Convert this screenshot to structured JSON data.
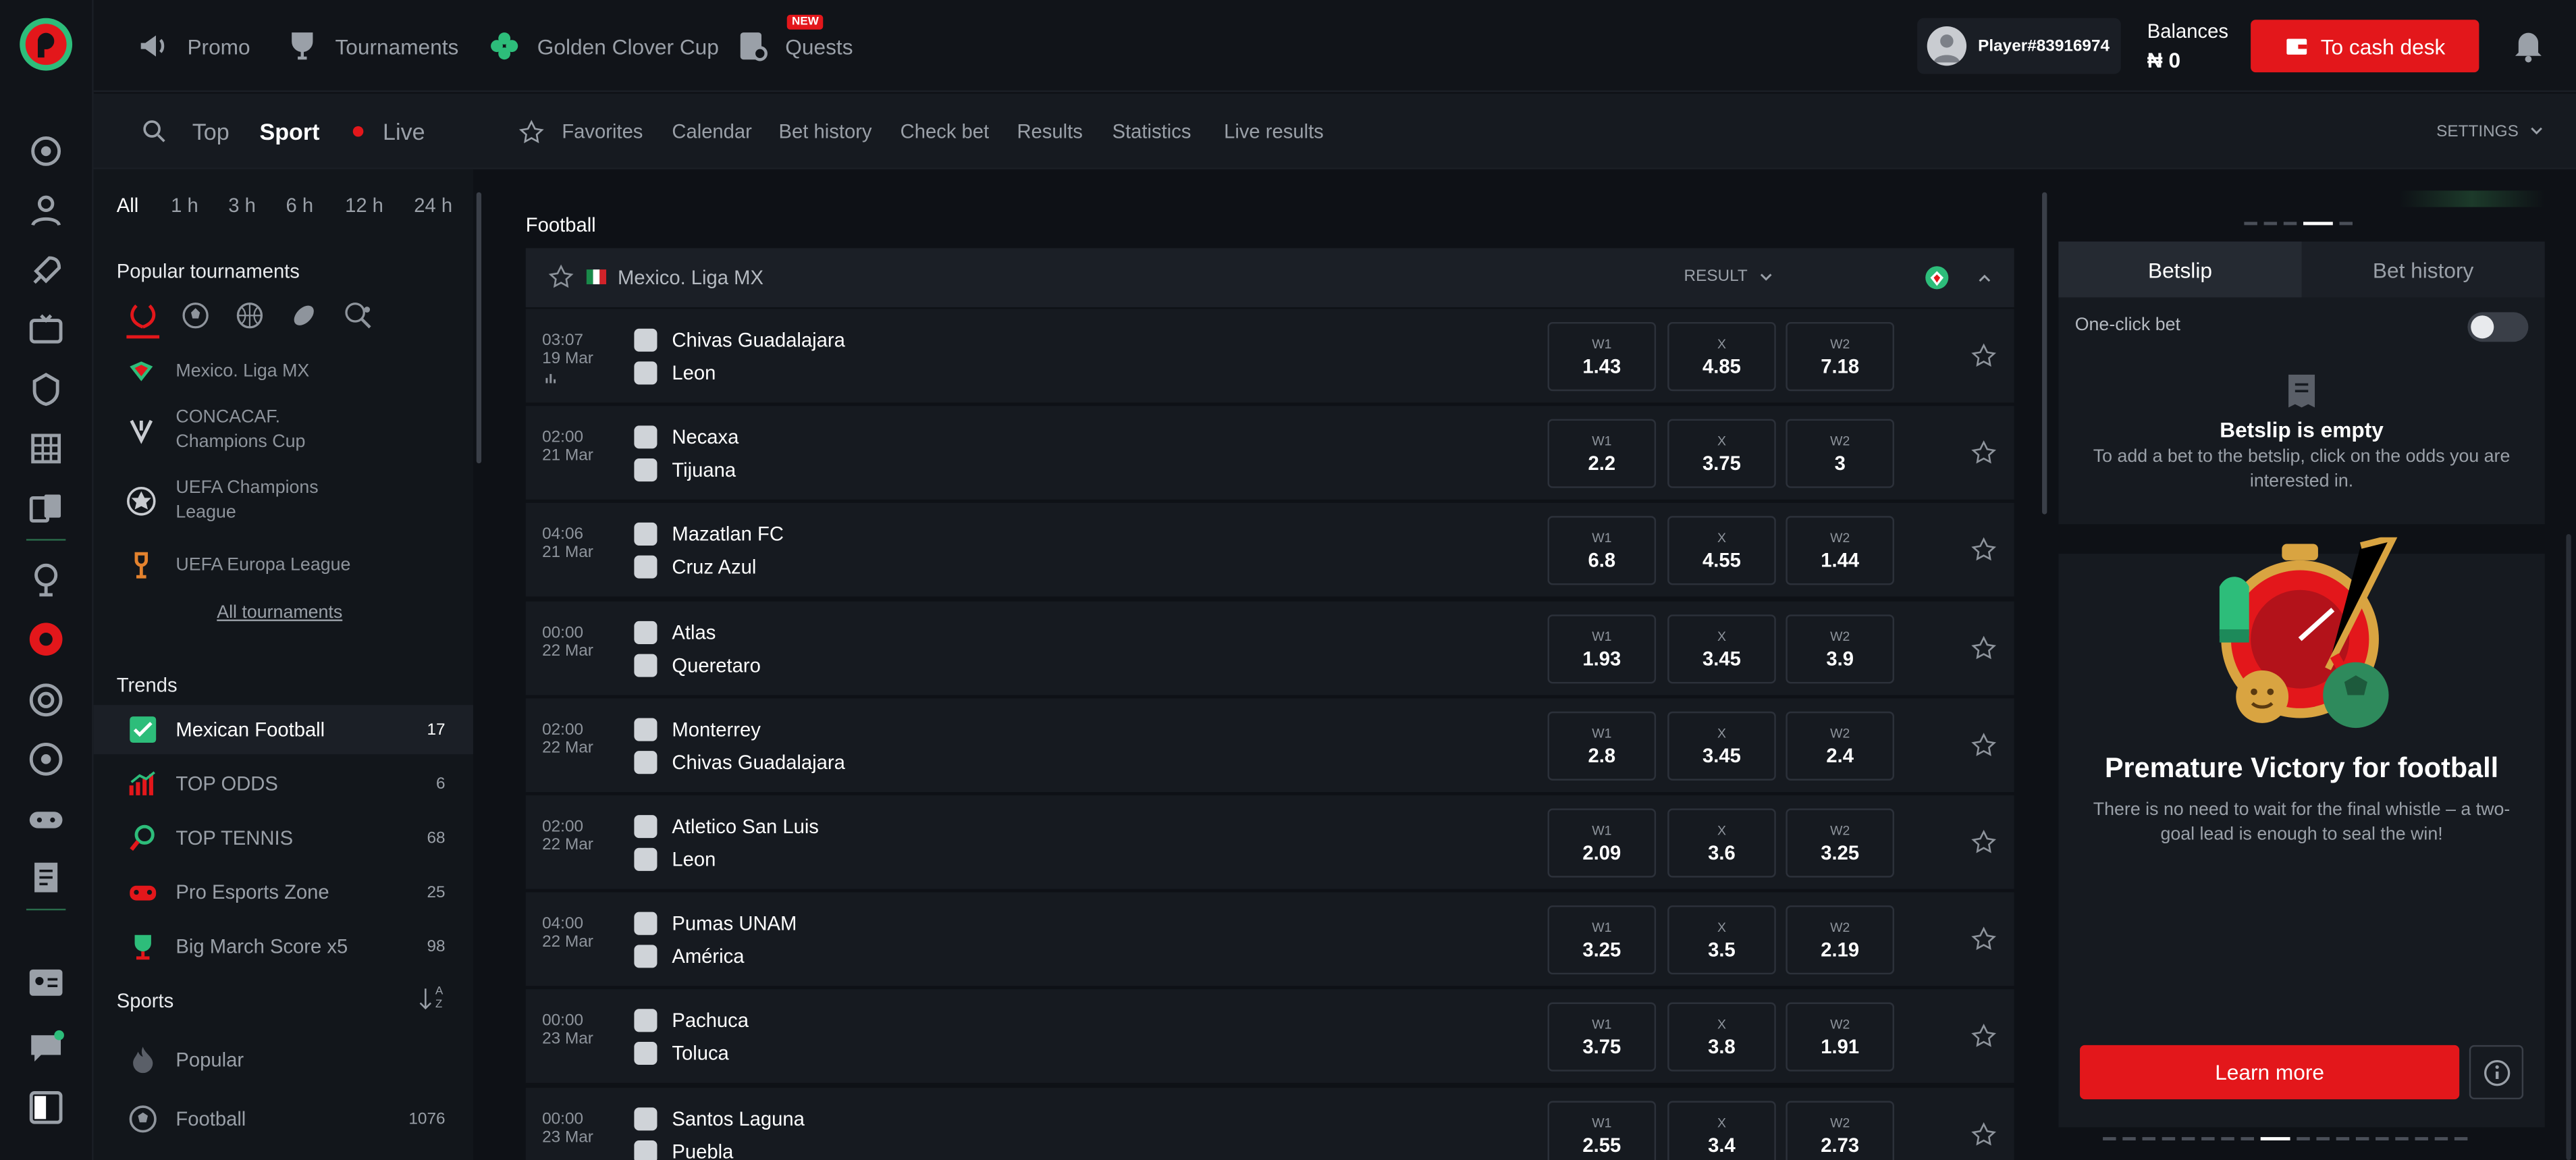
{
  "topbar": {
    "nav": [
      {
        "label": "Promo",
        "icon": "megaphone-icon"
      },
      {
        "label": "Tournaments",
        "icon": "trophy-icon"
      },
      {
        "label": "Golden Clover Cup",
        "icon": "clover-icon"
      },
      {
        "label": "Quests",
        "icon": "quests-icon",
        "badge": "NEW"
      }
    ],
    "player": "Player#83916974",
    "balances_label": "Balances",
    "balance": "₦ 0",
    "cash_desk": "To cash desk"
  },
  "subnav": {
    "modes": [
      "Top",
      "Sport",
      "Live"
    ],
    "links": [
      "Favorites",
      "Calendar",
      "Bet history",
      "Check bet",
      "Results",
      "Statistics",
      "Live results"
    ],
    "settings": "SETTINGS"
  },
  "left": {
    "filters": [
      "All",
      "1 h",
      "3 h",
      "6 h",
      "12 h",
      "24 h"
    ],
    "popular_title": "Popular tournaments",
    "tournaments": [
      "Mexico. Liga MX",
      "CONCACAF.\nChampions Cup",
      "UEFA Champions\nLeague",
      "UEFA Europa League"
    ],
    "all_tournaments": "All tournaments",
    "trends_title": "Trends",
    "trends": [
      {
        "label": "Mexican Football",
        "count": "17"
      },
      {
        "label": "TOP ODDS",
        "count": "6"
      },
      {
        "label": "TOP TENNIS",
        "count": "68"
      },
      {
        "label": "Pro Esports Zone",
        "count": "25"
      },
      {
        "label": "Big March Score x5",
        "count": "98"
      }
    ],
    "sports_title": "Sports",
    "sort_label": "A\nZ",
    "sports": [
      {
        "label": "Popular",
        "count": ""
      },
      {
        "label": "Football",
        "count": "1076"
      }
    ]
  },
  "center": {
    "section": "Football",
    "league": "Mexico. Liga MX",
    "result_label": "RESULT",
    "matches": [
      {
        "time": "03:07",
        "date": "19 Mar",
        "home": "Chivas Guadalajara",
        "away": "Leon",
        "w1": "1.43",
        "x": "4.85",
        "w2": "7.18"
      },
      {
        "time": "02:00",
        "date": "21 Mar",
        "home": "Necaxa",
        "away": "Tijuana",
        "w1": "2.2",
        "x": "3.75",
        "w2": "3"
      },
      {
        "time": "04:06",
        "date": "21 Mar",
        "home": "Mazatlan FC",
        "away": "Cruz Azul",
        "w1": "6.8",
        "x": "4.55",
        "w2": "1.44"
      },
      {
        "time": "00:00",
        "date": "22 Mar",
        "home": "Atlas",
        "away": "Queretaro",
        "w1": "1.93",
        "x": "3.45",
        "w2": "3.9"
      },
      {
        "time": "02:00",
        "date": "22 Mar",
        "home": "Monterrey",
        "away": "Chivas Guadalajara",
        "w1": "2.8",
        "x": "3.45",
        "w2": "2.4"
      },
      {
        "time": "02:00",
        "date": "22 Mar",
        "home": "Atletico San Luis",
        "away": "Leon",
        "w1": "2.09",
        "x": "3.6",
        "w2": "3.25"
      },
      {
        "time": "04:00",
        "date": "22 Mar",
        "home": "Pumas UNAM",
        "away": "América",
        "w1": "3.25",
        "x": "3.5",
        "w2": "2.19"
      },
      {
        "time": "00:00",
        "date": "23 Mar",
        "home": "Pachuca",
        "away": "Toluca",
        "w1": "3.75",
        "x": "3.8",
        "w2": "1.91"
      },
      {
        "time": "00:00",
        "date": "23 Mar",
        "home": "Santos Laguna",
        "away": "Puebla",
        "w1": "2.55",
        "x": "3.4",
        "w2": "2.73"
      }
    ],
    "odd_labels": [
      "W1",
      "X",
      "W2"
    ]
  },
  "right": {
    "tabs": [
      "Betslip",
      "Bet history"
    ],
    "one_click": "One-click bet",
    "empty_title": "Betslip is empty",
    "empty_text": "To add a bet to the betslip, click on the odds you are interested in.",
    "promo_title": "Premature Victory for football",
    "promo_text": "There is no need to wait for the final whistle – a two-goal lead is enough to seal the win!",
    "learn_more": "Learn more"
  },
  "colors": {
    "accent": "#e3171b",
    "bg": "#0e1116",
    "panel": "#161a20",
    "green": "#2dbd7a"
  }
}
